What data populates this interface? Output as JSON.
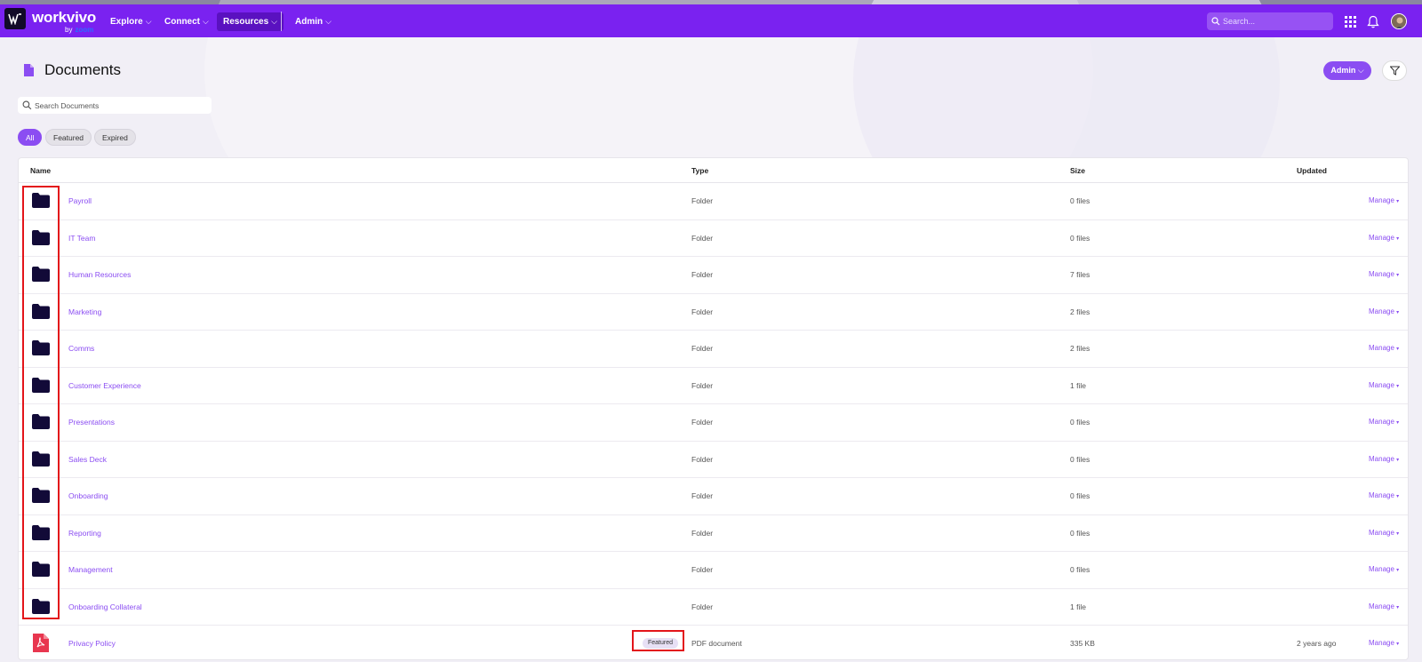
{
  "app": {
    "logo": "workvivo",
    "logo_by": "by",
    "logo_zoom": "zoom"
  },
  "nav": {
    "items": [
      {
        "label": "Explore"
      },
      {
        "label": "Connect"
      },
      {
        "label": "Resources"
      },
      {
        "label": "Admin"
      }
    ],
    "search_placeholder": "Search..."
  },
  "page": {
    "title": "Documents",
    "admin_label": "Admin",
    "search_placeholder": "Search Documents",
    "filters": [
      {
        "label": "All"
      },
      {
        "label": "Featured"
      },
      {
        "label": "Expired"
      }
    ]
  },
  "table": {
    "headers": {
      "name": "Name",
      "type": "Type",
      "size": "Size",
      "updated": "Updated"
    },
    "rows": [
      {
        "name": "Payroll",
        "type": "Folder",
        "size": "0 files",
        "updated": "",
        "manage": "Manage"
      },
      {
        "name": "IT Team",
        "type": "Folder",
        "size": "0 files",
        "updated": "",
        "manage": "Manage"
      },
      {
        "name": "Human Resources",
        "type": "Folder",
        "size": "7 files",
        "updated": "",
        "manage": "Manage"
      },
      {
        "name": "Marketing",
        "type": "Folder",
        "size": "2 files",
        "updated": "",
        "manage": "Manage"
      },
      {
        "name": "Comms",
        "type": "Folder",
        "size": "2 files",
        "updated": "",
        "manage": "Manage"
      },
      {
        "name": "Customer Experience",
        "type": "Folder",
        "size": "1 file",
        "updated": "",
        "manage": "Manage"
      },
      {
        "name": "Presentations",
        "type": "Folder",
        "size": "0 files",
        "updated": "",
        "manage": "Manage"
      },
      {
        "name": "Sales Deck",
        "type": "Folder",
        "size": "0 files",
        "updated": "",
        "manage": "Manage"
      },
      {
        "name": "Onboarding",
        "type": "Folder",
        "size": "0 files",
        "updated": "",
        "manage": "Manage"
      },
      {
        "name": "Reporting",
        "type": "Folder",
        "size": "0 files",
        "updated": "",
        "manage": "Manage"
      },
      {
        "name": "Management",
        "type": "Folder",
        "size": "0 files",
        "updated": "",
        "manage": "Manage"
      },
      {
        "name": "Onboarding Collateral",
        "type": "Folder",
        "size": "1 file",
        "updated": "",
        "manage": "Manage"
      },
      {
        "name": "Privacy Policy",
        "type": "PDF document",
        "size": "335 KB",
        "updated": "2 years ago",
        "manage": "Manage",
        "badge": "Featured"
      }
    ]
  },
  "colors": {
    "nav_bg": "#7a22f0",
    "accent": "#8b4df2",
    "folder_icon": "#120a38",
    "pdf_icon": "#e8364f",
    "highlight": "#e3151a"
  }
}
